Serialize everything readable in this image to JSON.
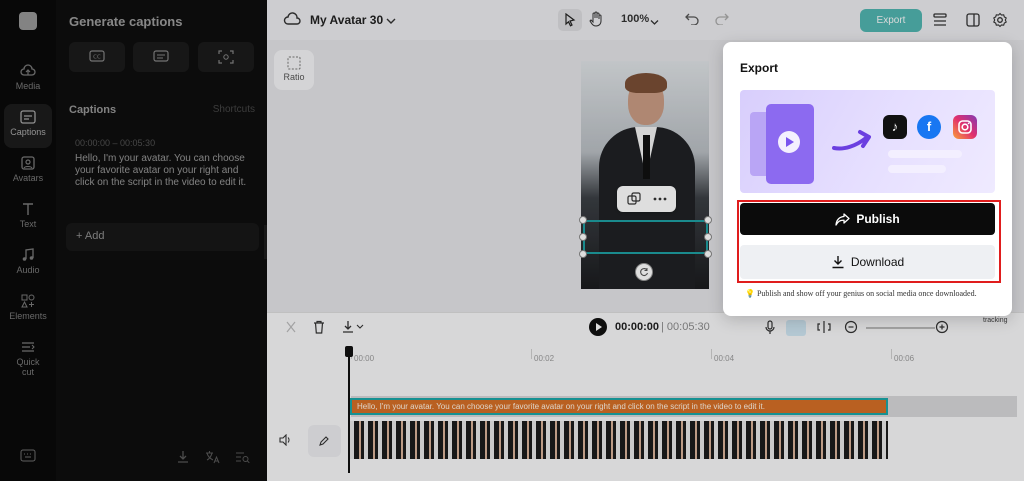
{
  "rail": {
    "items": [
      {
        "label": "Media",
        "icon": "cloud-upload-icon"
      },
      {
        "label": "Captions",
        "icon": "captions-icon"
      },
      {
        "label": "Avatars",
        "icon": "avatar-icon"
      },
      {
        "label": "Text",
        "icon": "text-icon"
      },
      {
        "label": "Audio",
        "icon": "music-note-icon"
      },
      {
        "label": "Elements",
        "icon": "elements-icon"
      },
      {
        "label": "Quick",
        "label2": "cut",
        "icon": "quick-cut-icon"
      }
    ]
  },
  "panel": {
    "title": "Generate captions",
    "section_title": "Captions",
    "shortcuts": "Shortcuts",
    "caption": {
      "time": "00:00:00 – 00:05:30",
      "text": "Hello, I'm your avatar. You can choose your favorite avatar on your right and click on the script in the video to edit it."
    },
    "add_label": "+ Add"
  },
  "topbar": {
    "project_name": "My Avatar 30",
    "zoom": "100%",
    "export_label": "Export"
  },
  "canvas": {
    "ratio_label": "Ratio"
  },
  "timeline": {
    "current_time": "00:00:00",
    "duration": "| 00:05:30",
    "ticks": [
      "00:00",
      "00:02",
      "00:04",
      "00:06"
    ],
    "caption_clip": "Hello, I'm your avatar. You can choose your favorite avatar on your right and click on the script in the video to edit it.",
    "tracking_label": "tracking"
  },
  "export_panel": {
    "title": "Export",
    "publish_label": "Publish",
    "download_label": "Download",
    "tip": "Publish and show off your genius on social media once downloaded.",
    "colors": {
      "accent": "#1ea39b",
      "highlight": "#e01d1d",
      "publish_bg": "#0b0b0b"
    }
  }
}
